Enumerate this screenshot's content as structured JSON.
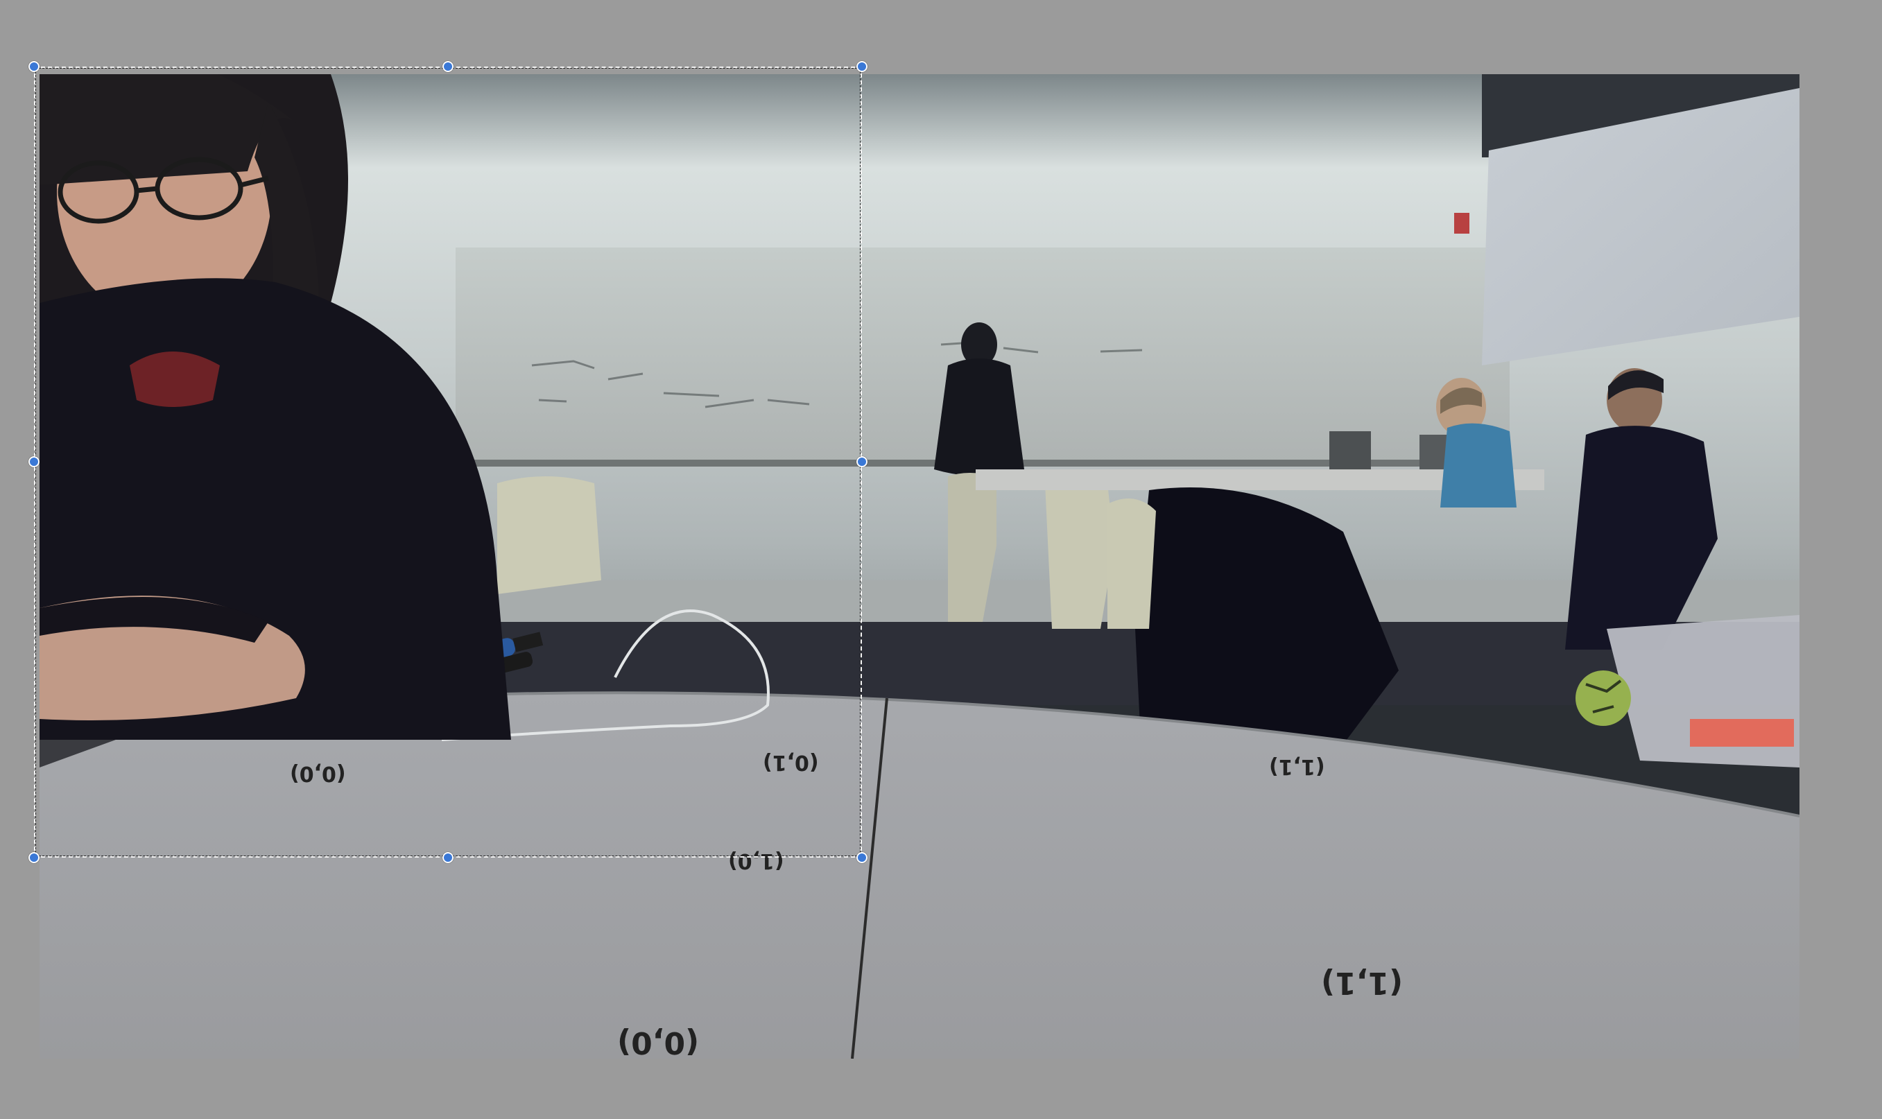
{
  "editor": {
    "background_color": "#9b9b9b",
    "selection_handle_color": "#3a78d6"
  },
  "image": {
    "description_icon": "photo-image",
    "table_marks": [
      "(0,0)",
      "(0,1)",
      "(1,0)",
      "(1,1)"
    ]
  },
  "selection": {
    "style": "dashed",
    "handles": [
      "top-left",
      "top-center",
      "top-right",
      "middle-left",
      "middle-right",
      "bottom-left",
      "bottom-center",
      "bottom-right"
    ]
  }
}
